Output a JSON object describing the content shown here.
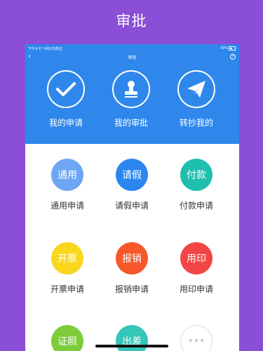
{
  "header": {
    "title": "审批"
  },
  "status_bar": {
    "time": "下午4:17  4月2日周五",
    "battery": "39%"
  },
  "nav": {
    "back": "‹",
    "title": "审批",
    "help": "?"
  },
  "top_actions": [
    {
      "label": "我的申请",
      "icon": "check-icon"
    },
    {
      "label": "我的审批",
      "icon": "stamp-icon"
    },
    {
      "label": "转抄我的",
      "icon": "paper-plane-icon"
    }
  ],
  "grid": [
    {
      "icon_text": "通用",
      "label": "通用申请",
      "color": "#6ea5f4"
    },
    {
      "icon_text": "请假",
      "label": "请假申请",
      "color": "#2b86ee"
    },
    {
      "icon_text": "付款",
      "label": "付款申请",
      "color": "#1fbfb0"
    },
    {
      "icon_text": "开票",
      "label": "开票申请",
      "color": "#f9d71d"
    },
    {
      "icon_text": "报销",
      "label": "报销申请",
      "color": "#f7572a"
    },
    {
      "icon_text": "用印",
      "label": "用印申请",
      "color": "#f14545"
    },
    {
      "icon_text": "证照",
      "label": "",
      "color": "#7ccc3c"
    },
    {
      "icon_text": "出差",
      "label": "",
      "color": "#35c6b8"
    },
    {
      "icon_text": "•••",
      "label": "",
      "color": "#ffffff"
    }
  ],
  "colors": {
    "background": "#8a4fd6",
    "header_blue": "#2f87eb"
  }
}
